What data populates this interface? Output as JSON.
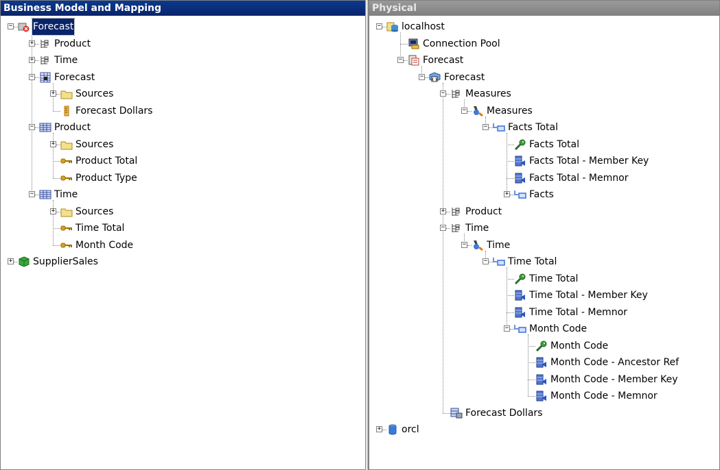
{
  "left_panel": {
    "title": "Business Model and Mapping",
    "nodes": [
      {
        "label": "Forecast",
        "icon": "business-model-icon",
        "selected": true
      },
      {
        "label": "Product",
        "icon": "hierarchy-icon"
      },
      {
        "label": "Time",
        "icon": "hierarchy-icon"
      },
      {
        "label": "Forecast",
        "icon": "fact-table-icon"
      },
      {
        "label": "Sources",
        "icon": "folder-icon"
      },
      {
        "label": "Forecast Dollars",
        "icon": "measure-icon"
      },
      {
        "label": "Product",
        "icon": "dimension-table-icon"
      },
      {
        "label": "Sources",
        "icon": "folder-icon"
      },
      {
        "label": "Product Total",
        "icon": "key-icon"
      },
      {
        "label": "Product Type",
        "icon": "key-icon"
      },
      {
        "label": "Time",
        "icon": "dimension-table-icon"
      },
      {
        "label": "Sources",
        "icon": "folder-icon"
      },
      {
        "label": "Time Total",
        "icon": "key-icon"
      },
      {
        "label": "Month Code",
        "icon": "key-icon"
      },
      {
        "label": "SupplierSales",
        "icon": "cube-icon"
      }
    ]
  },
  "right_panel": {
    "title": "Physical",
    "nodes": [
      {
        "label": "localhost",
        "icon": "database-icon"
      },
      {
        "label": "Connection Pool",
        "icon": "connection-pool-icon"
      },
      {
        "label": "Forecast",
        "icon": "catalog-icon"
      },
      {
        "label": "Forecast",
        "icon": "cube-table-icon"
      },
      {
        "label": "Measures",
        "icon": "hierarchy-icon"
      },
      {
        "label": "Measures",
        "icon": "level-icon"
      },
      {
        "label": "Facts Total",
        "icon": "level-member-icon"
      },
      {
        "label": "Facts Total",
        "icon": "column-key-icon"
      },
      {
        "label": "Facts Total - Member Key",
        "icon": "column-icon"
      },
      {
        "label": "Facts Total - Memnor",
        "icon": "column-icon"
      },
      {
        "label": "Facts",
        "icon": "level-member-icon"
      },
      {
        "label": "Product",
        "icon": "hierarchy-icon"
      },
      {
        "label": "Time",
        "icon": "hierarchy-icon"
      },
      {
        "label": "Time",
        "icon": "level-icon"
      },
      {
        "label": "Time Total",
        "icon": "level-member-icon"
      },
      {
        "label": "Time Total",
        "icon": "column-key-icon"
      },
      {
        "label": "Time Total - Member Key",
        "icon": "column-icon"
      },
      {
        "label": "Time Total - Memnor",
        "icon": "column-icon"
      },
      {
        "label": "Month Code",
        "icon": "level-member-icon"
      },
      {
        "label": "Month Code",
        "icon": "column-key-icon"
      },
      {
        "label": "Month Code - Ancestor Ref",
        "icon": "column-icon"
      },
      {
        "label": "Month Code - Member Key",
        "icon": "column-icon"
      },
      {
        "label": "Month Code - Memnor",
        "icon": "column-icon"
      },
      {
        "label": "Forecast Dollars",
        "icon": "measure-column-icon"
      },
      {
        "label": "orcl",
        "icon": "database-cylinder-icon"
      }
    ]
  },
  "colors": {
    "selection": "#0a246a",
    "header_active": "#0a246a",
    "header_inactive": "#808080"
  }
}
